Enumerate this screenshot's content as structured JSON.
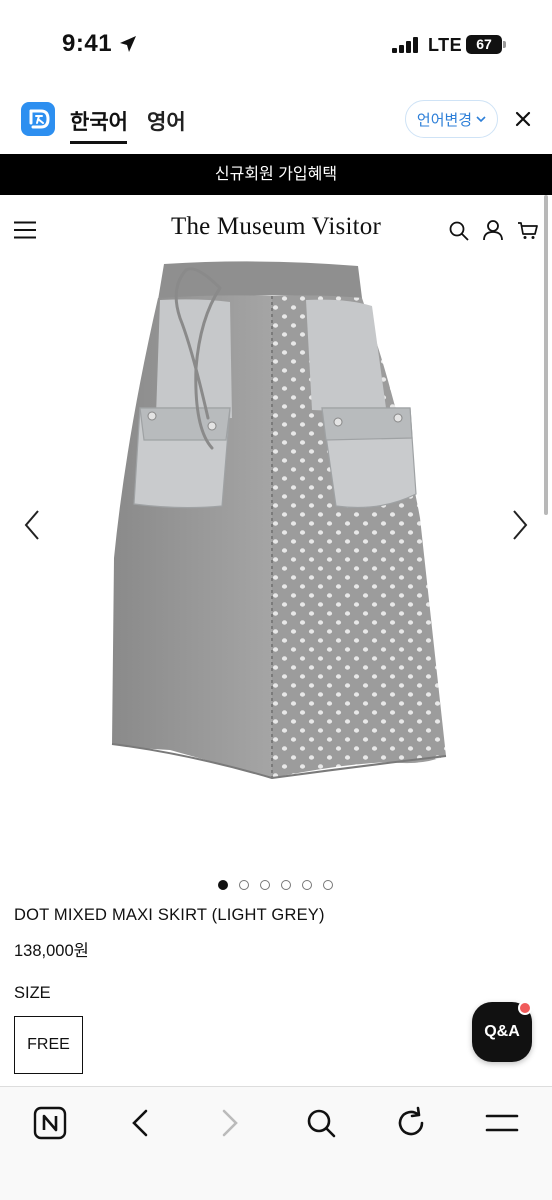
{
  "status_bar": {
    "time": "9:41",
    "carrier": "LTE",
    "battery": "67",
    "icons": [
      "location-arrow-icon",
      "signal-bars-icon",
      "battery-icon"
    ]
  },
  "translate_bar": {
    "tabs": [
      {
        "label": "한국어",
        "active": true
      },
      {
        "label": "영어",
        "active": false
      }
    ],
    "change_language_label": "언어변경",
    "icons": [
      "translate-logo-icon",
      "chevron-down-icon",
      "close-icon"
    ]
  },
  "promo_banner": {
    "text": "신규회원 가입혜택"
  },
  "site_header": {
    "brand": "The Museum Visitor",
    "icons": [
      "hamburger-menu-icon",
      "search-icon",
      "user-icon",
      "cart-icon"
    ]
  },
  "product": {
    "name": "DOT MIXED MAXI SKIRT (LIGHT GREY)",
    "price": "138,000원",
    "gallery": {
      "image_count": 6,
      "active_index": 0,
      "icons": [
        "chevron-left-icon",
        "chevron-right-icon"
      ]
    },
    "size_label": "SIZE",
    "size_options": [
      "FREE"
    ]
  },
  "qa_button": {
    "label": "Q&A"
  },
  "bottom_toolbar": {
    "icons": [
      "naver-home-icon",
      "back-icon",
      "forward-icon",
      "search-icon",
      "reload-icon",
      "menu-icon"
    ]
  },
  "colors": {
    "accent_blue": "#2d8ff0",
    "banner_bg": "#000000",
    "notification_red": "#f05a5a",
    "skirt_grey": "#9a9a9a"
  }
}
